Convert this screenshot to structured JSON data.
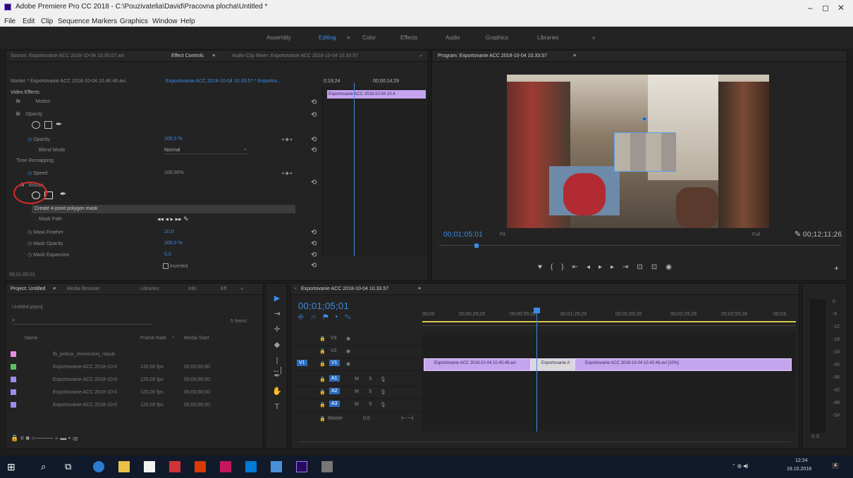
{
  "window": {
    "title": "Adobe Premiere Pro CC 2018 - C:\\Pouzivatelia\\David\\Pracovna plocha\\Untitled *",
    "min": "–",
    "max": "◻",
    "close": "✕"
  },
  "menu": [
    "File",
    "Edit",
    "Clip",
    "Sequence",
    "Markers",
    "Graphics",
    "Window",
    "Help"
  ],
  "workspaces": {
    "items": [
      "Assembly",
      "Editing",
      "Color",
      "Effects",
      "Audio",
      "Graphics",
      "Libraries"
    ],
    "active": "Editing",
    "editing_menu": "≡",
    "more": "»"
  },
  "source_panel": {
    "tabs": [
      "Source: Exportovanie ACC 2018-10-04 10.35.07.avi",
      "Effect Controls",
      "Audio Clip Mixer: Exportovanie ACC 2018-10-04 10.33.57"
    ],
    "tab_menu": "≡",
    "overflow": "»",
    "clip_path": "Master * Exportovanie ACC 2018-10-04 10.40.46.avi",
    "clip_seq": "Exportovanie ACC 2018-10-04 10.33.57 * Exportov...",
    "mini_timecode_1": "0;19;24",
    "mini_timecode_2": "00;00;14;29",
    "mini_clip_label": "Exportovanie ACC 2018-10-04 10.4",
    "section": "Video Effects",
    "effects": [
      {
        "fx": "fx",
        "name": "Motion"
      },
      {
        "fx": "fx",
        "name": "Opacity"
      }
    ],
    "opacity": {
      "label": "Opacity",
      "value": "100,0 %"
    },
    "blend": {
      "label": "Blend Mode",
      "value": "Normal"
    },
    "time_remap": {
      "label": "Time Remapping"
    },
    "speed": {
      "label": "Speed",
      "value": "100,00%"
    },
    "mosaic": {
      "fx": "fx",
      "name": "Mosaic"
    },
    "tooltip": "Create 4-point polygon mask",
    "mask_props": [
      {
        "label": "Mask Path",
        "value": ""
      },
      {
        "label": "Mask Feather",
        "value": "10,0"
      },
      {
        "label": "Mask Opacity",
        "value": "100,0 %"
      },
      {
        "label": "Mask Expansion",
        "value": "0,0"
      }
    ],
    "inverted": "Inverted",
    "current_time": "00;01;05;01"
  },
  "program_panel": {
    "title": "Program: Exportovanie ACC 2018-10-04 10.33.57",
    "title_menu": "≡",
    "timecode": "00;01;05;01",
    "fit": "Fit",
    "quality": "Full",
    "duration": "00;12;11;26"
  },
  "project_panel": {
    "tabs": [
      "Project: Untitled",
      "Media Browser",
      "Libraries",
      "Info",
      "Eff",
      "»"
    ],
    "tab_menu": "≡",
    "project_file": "Untitled.prproj",
    "items_count": "5 Items",
    "columns": {
      "name": "Name",
      "frame_rate": "Frame Rate",
      "media_start": "Media Start"
    },
    "sort_arrow": "⌃",
    "rows": [
      {
        "color": "#e78de3",
        "name": "fb_policia_slovenskej_repub",
        "fps": "",
        "start": ""
      },
      {
        "color": "#59c45c",
        "name": "Exportovanie ACC 2018-10-0",
        "fps": "120,00 fps",
        "start": "00;00;00;00"
      },
      {
        "color": "#9a8df0",
        "name": "Exportovanie ACC 2018-10-0",
        "fps": "120,00 fps",
        "start": "00;00;00;00"
      },
      {
        "color": "#9a8df0",
        "name": "Exportovanie ACC 2018-10-0",
        "fps": "120,00 fps",
        "start": "00;00;00;00"
      },
      {
        "color": "#9a8df0",
        "name": "Exportovanie ACC 2018-10-0",
        "fps": "120,00 fps",
        "start": "00;00;00;00"
      }
    ]
  },
  "timeline_panel": {
    "title": "Exportovanie ACC 2018-10-04 10.33.57",
    "title_menu": "≡",
    "timecode": "00;01;05;01",
    "ruler": [
      "00;00",
      "00;00;29;29",
      "00;00;59;28",
      "00;01;29;29",
      "00;01;59;28",
      "00;02;29;29",
      "00;02;59;28",
      "00;03;"
    ],
    "video_tracks": [
      "V3",
      "V2",
      "V1"
    ],
    "audio_tracks": [
      "A1",
      "A2",
      "A3"
    ],
    "master": "Master",
    "master_val": "0,0",
    "clips": [
      "Exportovanie ACC 2018-10-04 10.40.46.avi",
      "Exportovanie A",
      "Exportovanie ACC 2018-10-04 10.40.46.avi [10%]"
    ],
    "track_labels": {
      "src": "V1",
      "m": "M",
      "s": "S"
    }
  },
  "meter": {
    "labels": [
      "0",
      "-6",
      "-12",
      "-18",
      "-24",
      "-30",
      "-36",
      "-42",
      "-48",
      "-54"
    ],
    "footer": "S S"
  },
  "taskbar": {
    "time": "12:24",
    "date": "19.10.2018",
    "notif": "4"
  }
}
